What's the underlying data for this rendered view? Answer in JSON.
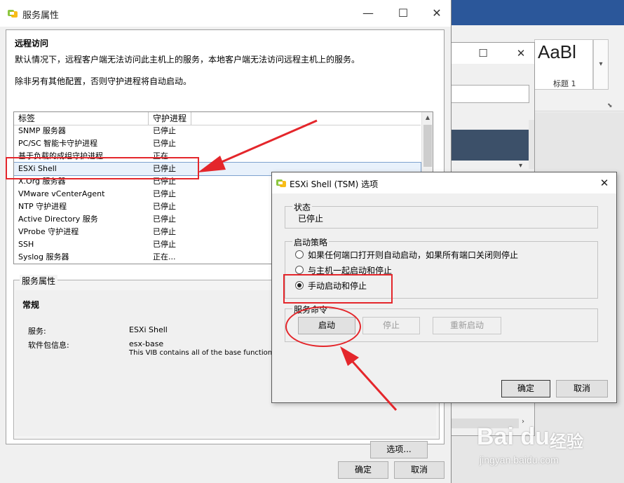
{
  "background_window": {
    "style_sample": "AaBl",
    "style_name": "标题 1"
  },
  "main_window": {
    "title": "服务属性",
    "section_title": "远程访问",
    "description_1": "默认情况下，远程客户端无法访问此主机上的服务，本地客户端无法访问远程主机上的服务。",
    "description_2": "除非另有其他配置，否则守护进程将自动启动。",
    "columns": {
      "label": "标签",
      "daemon": "守护进程"
    },
    "rows": [
      {
        "label": "SNMP 服务器",
        "status": "已停止"
      },
      {
        "label": "PC/SC 智能卡守护进程",
        "status": "已停止"
      },
      {
        "label": "基于负载的成组守护进程",
        "status": "正在..."
      },
      {
        "label": "ESXi Shell",
        "status": "已停止"
      },
      {
        "label": "X.Org 服务器",
        "status": "已停止"
      },
      {
        "label": "VMware vCenterAgent",
        "status": "已停止"
      },
      {
        "label": "NTP 守护进程",
        "status": "已停止"
      },
      {
        "label": "Active Directory 服务",
        "status": "已停止"
      },
      {
        "label": "VProbe 守护进程",
        "status": "已停止"
      },
      {
        "label": "SSH",
        "status": "已停止"
      },
      {
        "label": "Syslog 服务器",
        "status": "正在..."
      }
    ],
    "selected_index": 3,
    "props_legend": "服务属性",
    "props_title": "常规",
    "service_label": "服务:",
    "service_value": "ESXi Shell",
    "package_label": "软件包信息:",
    "package_value": "esx-base",
    "package_desc": "This VIB contains all of the base functionality",
    "options_button": "选项...",
    "ok_button": "确定",
    "cancel_button": "取消"
  },
  "dialog": {
    "title": "ESXi Shell (TSM) 选项",
    "status_legend": "状态",
    "status_value": "已停止",
    "policy_legend": "启动策略",
    "policy_options": [
      "如果任何端口打开则自动启动，如果所有端口关闭则停止",
      "与主机一起启动和停止",
      "手动启动和停止"
    ],
    "selected_policy": 2,
    "commands_legend": "服务命令",
    "start_button": "启动",
    "stop_button": "停止",
    "restart_button": "重新启动",
    "ok_button": "确定",
    "cancel_button": "取消"
  },
  "watermark": {
    "logo": "Bai du",
    "brand": "经验",
    "url": "jingyan.baidu.com"
  },
  "colors": {
    "annotation": "#e4262b",
    "selection": "#e8f1fb",
    "ribbon": "#2b579a"
  }
}
